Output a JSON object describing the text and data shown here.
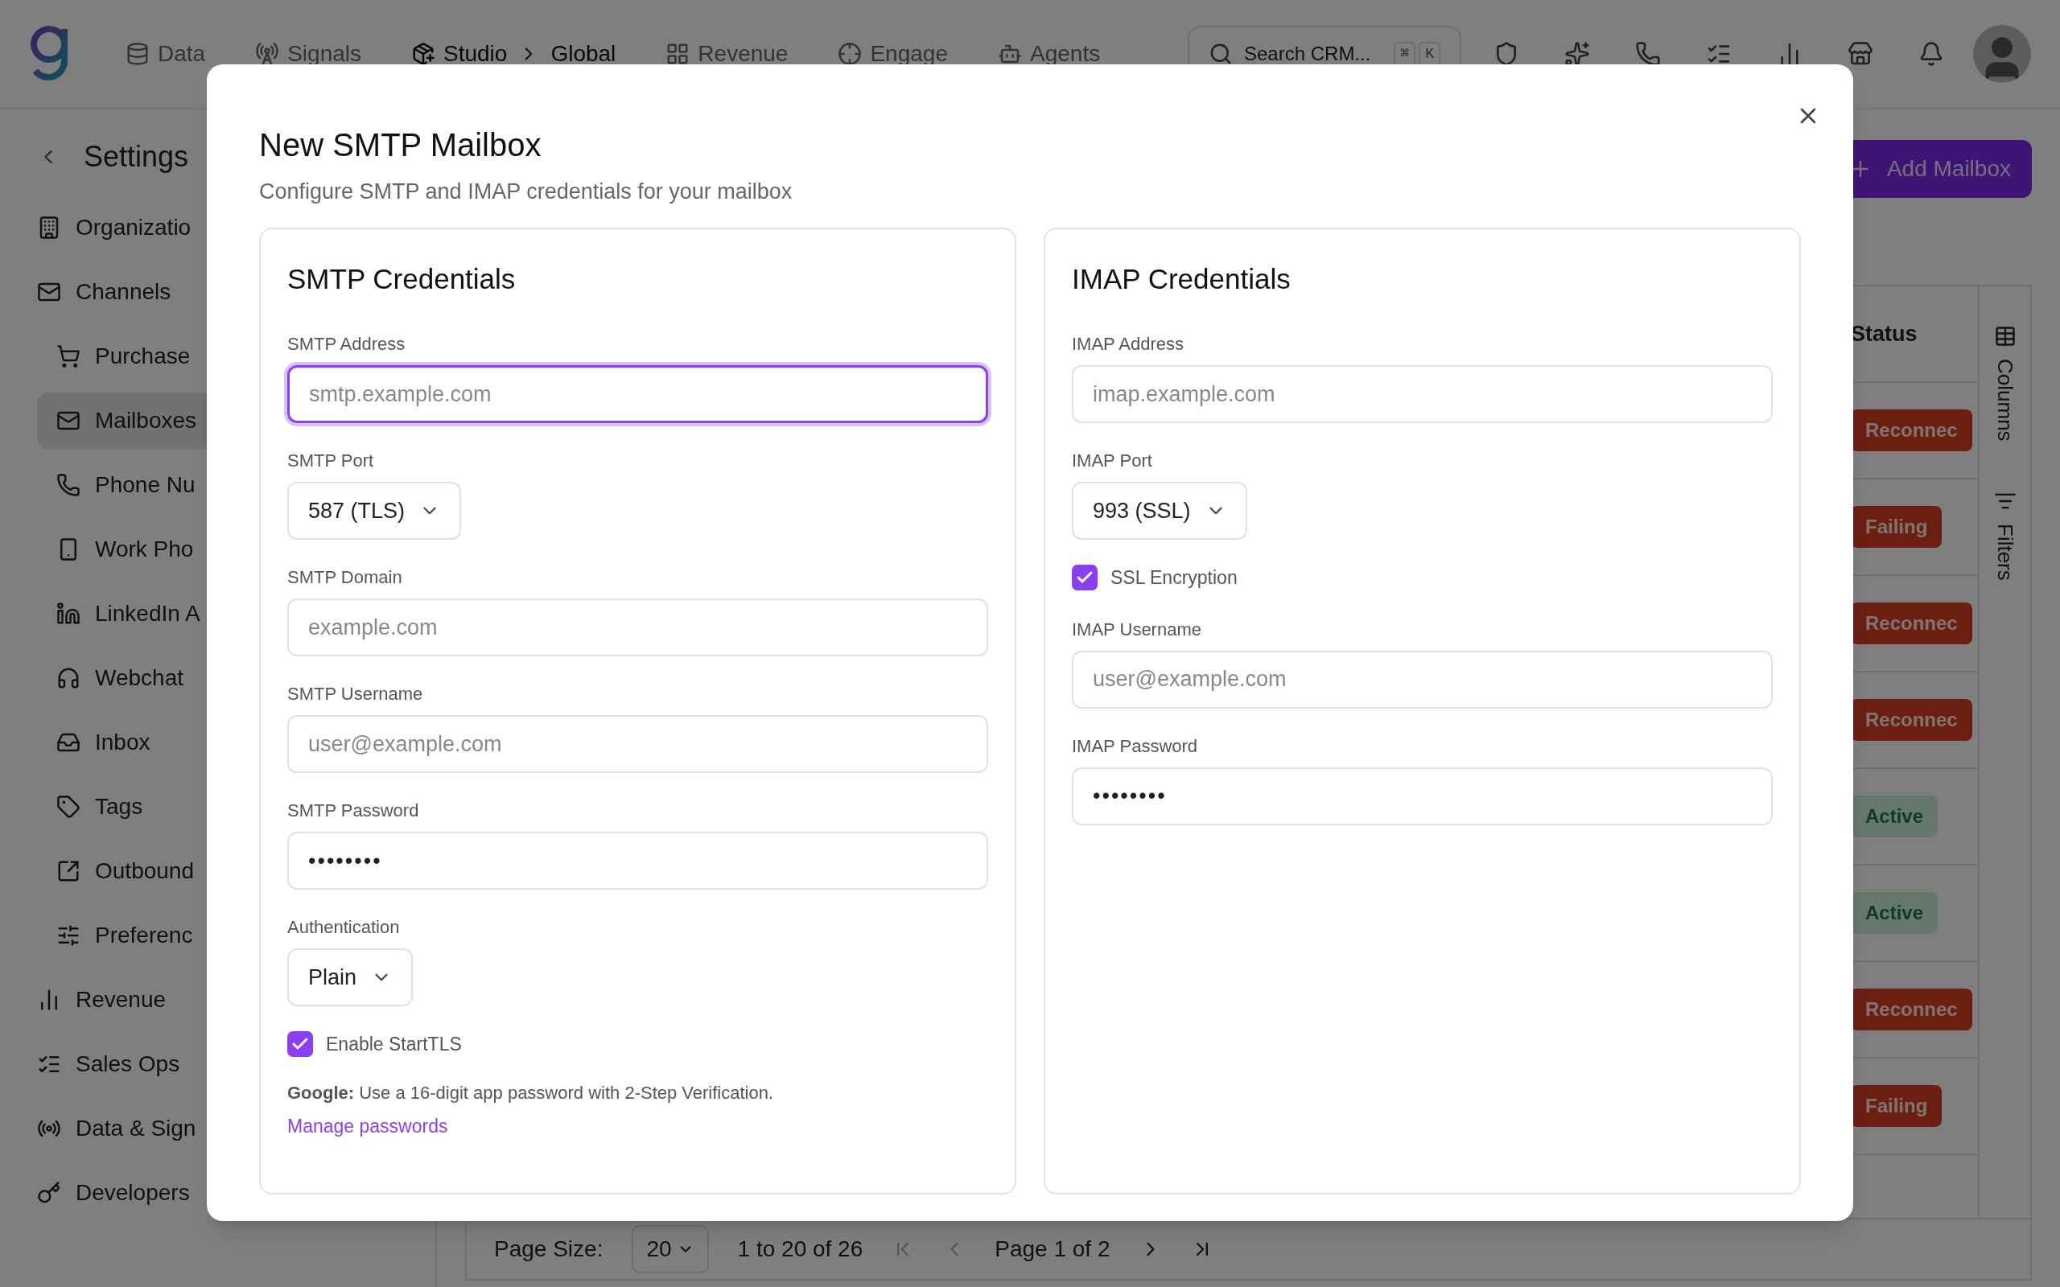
{
  "topbar": {
    "nav": [
      {
        "label": "Data",
        "selected": false
      },
      {
        "label": "Signals",
        "selected": false
      },
      {
        "label": "Studio",
        "selected": true,
        "crumb": "Global"
      },
      {
        "label": "Revenue",
        "selected": false
      },
      {
        "label": "Engage",
        "selected": false
      },
      {
        "label": "Agents",
        "selected": false
      }
    ],
    "search": {
      "placeholder": "Search CRM...",
      "keys": [
        "⌘",
        "K"
      ]
    }
  },
  "sidebar": {
    "title": "Settings",
    "items": [
      {
        "label": "Organizatio",
        "kind": "section",
        "selected": false
      },
      {
        "label": "Channels",
        "kind": "section",
        "selected": false
      },
      {
        "label": "Purchase",
        "kind": "sub",
        "selected": false
      },
      {
        "label": "Mailboxes",
        "kind": "sub",
        "selected": true
      },
      {
        "label": "Phone Nu",
        "kind": "sub",
        "selected": false
      },
      {
        "label": "Work Pho",
        "kind": "sub",
        "selected": false
      },
      {
        "label": "LinkedIn A",
        "kind": "sub",
        "selected": false
      },
      {
        "label": "Webchat",
        "kind": "sub",
        "selected": false
      },
      {
        "label": "Inbox",
        "kind": "sub",
        "selected": false
      },
      {
        "label": "Tags",
        "kind": "sub",
        "selected": false
      },
      {
        "label": "Outbound",
        "kind": "sub",
        "selected": false
      },
      {
        "label": "Preferenc",
        "kind": "sub",
        "selected": false
      },
      {
        "label": "Revenue",
        "kind": "section",
        "selected": false
      },
      {
        "label": "Sales Ops",
        "kind": "section",
        "selected": false
      },
      {
        "label": "Data & Sign",
        "kind": "section",
        "selected": false
      },
      {
        "label": "Developers",
        "kind": "section",
        "selected": false
      }
    ]
  },
  "main": {
    "add_button": "Add Mailbox",
    "table": {
      "columns": [
        "Status"
      ],
      "rows": [
        {
          "status": "Reconnec",
          "kind": "danger"
        },
        {
          "status": "Failing",
          "kind": "danger"
        },
        {
          "status": "Reconnec",
          "kind": "danger"
        },
        {
          "status": "Reconnec",
          "kind": "danger"
        },
        {
          "status": "Active",
          "kind": "success"
        },
        {
          "status": "Active",
          "kind": "success"
        },
        {
          "status": "Reconnec",
          "kind": "danger"
        },
        {
          "status": "Failing",
          "kind": "danger"
        }
      ]
    },
    "side_panel": [
      "Columns",
      "Filters"
    ],
    "pagination": {
      "page_size_label": "Page Size:",
      "page_size": "20",
      "range": "1 to 20 of 26",
      "page": "Page 1 of 2"
    }
  },
  "dialog": {
    "title": "New SMTP Mailbox",
    "subtitle": "Configure SMTP and IMAP credentials for your mailbox",
    "cards": [
      {
        "title": "SMTP Credentials",
        "fields": [
          {
            "kind": "input",
            "label": "SMTP Address",
            "placeholder": "smtp.example.com",
            "focused": true
          },
          {
            "kind": "select",
            "label": "SMTP Port",
            "value": "587 (TLS)"
          },
          {
            "kind": "input",
            "label": "SMTP Domain",
            "placeholder": "example.com",
            "focused": false
          },
          {
            "kind": "input",
            "label": "SMTP Username",
            "placeholder": "user@example.com",
            "focused": false
          },
          {
            "kind": "input",
            "label": "SMTP Password",
            "value": "••••••••",
            "focused": false
          },
          {
            "kind": "select",
            "label": "Authentication",
            "value": "Plain"
          },
          {
            "kind": "checkbox",
            "label": "Enable StartTLS",
            "checked": true
          },
          {
            "kind": "note",
            "text": "**Google:** Use a 16-digit app password with 2-Step Verification.",
            "link": "Manage passwords"
          }
        ]
      },
      {
        "title": "IMAP Credentials",
        "fields": [
          {
            "kind": "input",
            "label": "IMAP Address",
            "placeholder": "imap.example.com",
            "focused": false
          },
          {
            "kind": "select",
            "label": "IMAP Port",
            "value": "993 (SSL)"
          },
          {
            "kind": "checkbox",
            "label": "SSL Encryption",
            "checked": true
          },
          {
            "kind": "input",
            "label": "IMAP Username",
            "placeholder": "user@example.com",
            "focused": false
          },
          {
            "kind": "input",
            "label": "IMAP Password",
            "value": "••••••••",
            "focused": false
          }
        ]
      }
    ]
  }
}
